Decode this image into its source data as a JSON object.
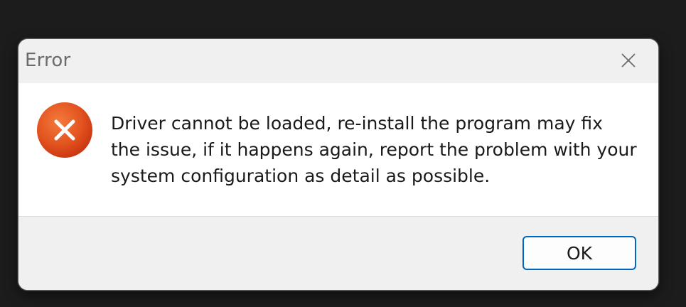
{
  "dialog": {
    "title": "Error",
    "close_icon": "close-icon",
    "error_icon": "error-icon",
    "message": "Driver cannot be loaded, re-install the program may fix the issue, if it happens again, report the problem with your system configuration as detail as possible.",
    "ok_label": "OK"
  },
  "colors": {
    "backdrop": "#1c1c1c",
    "dialog_bg": "#f0f0f0",
    "content_bg": "#ffffff",
    "button_border": "#0067c0",
    "error_red_light": "#f26a32",
    "error_red_dark": "#c8320e"
  }
}
